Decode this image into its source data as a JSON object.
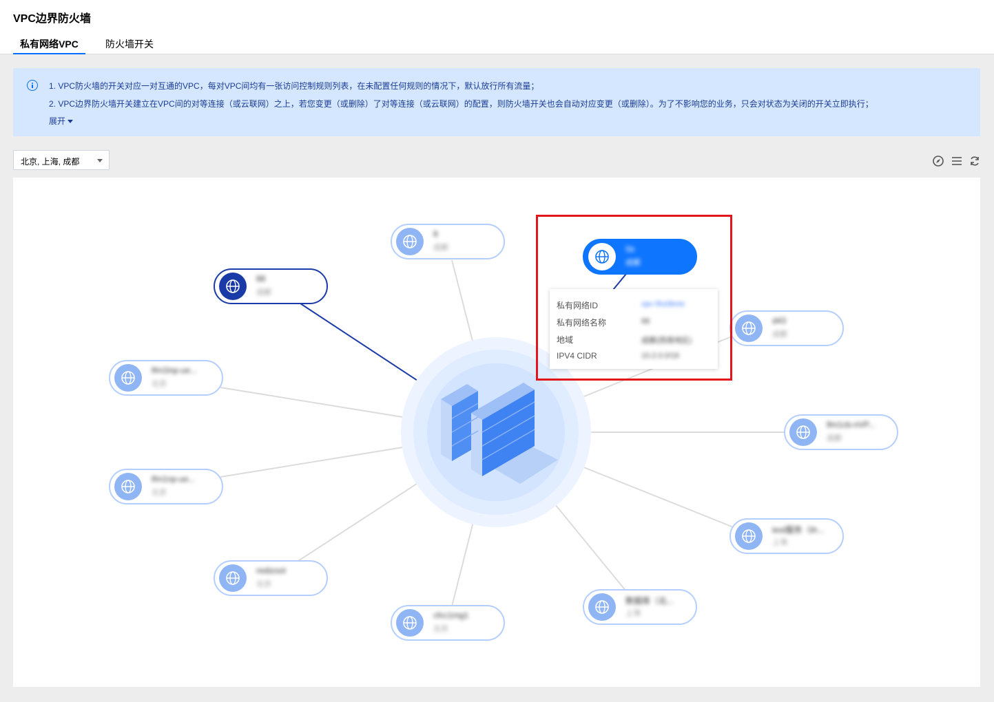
{
  "header": {
    "title": "VPC边界防火墙"
  },
  "tabs": [
    {
      "label": "私有网络VPC",
      "active": true
    },
    {
      "label": "防火墙开关",
      "active": false
    }
  ],
  "notice": {
    "line1": "1. VPC防火墙的开关对应一对互通的VPC，每对VPC间均有一张访问控制规则列表，在未配置任何规则的情况下，默认放行所有流量；",
    "line2": "2. VPC边界防火墙开关建立在VPC间的对等连接（或云联网）之上，若您变更（或删除）了对等连接（或云联网）的配置，则防火墙开关也会自动对应变更（或删除）。为了不影响您的业务，只会对状态为关闭的开关立即执行；",
    "expand_label": "展开"
  },
  "region_select": {
    "value": "北京, 上海, 成都"
  },
  "toolbar": {
    "icons": [
      "compass-icon",
      "list-icon",
      "refresh-icon"
    ]
  },
  "colors": {
    "accent": "#006eff",
    "node_border": "#b3ceff",
    "node_globe": "#8fb5f5",
    "selected": "#1a3aa8",
    "active": "#0e75ff",
    "highlight": "#e2141c"
  },
  "nodes": [
    {
      "name": "8",
      "sub": "成都",
      "state": "normal"
    },
    {
      "name": "88",
      "sub": "成都",
      "state": "selected"
    },
    {
      "name": "5b",
      "sub": "成都",
      "state": "active"
    },
    {
      "name": "d43",
      "sub": "成都",
      "state": "normal"
    },
    {
      "name": "lfm1lnp-ue...",
      "sub": "北京",
      "state": "normal"
    },
    {
      "name": "lfm1cb-nVP...",
      "sub": "成都",
      "state": "normal"
    },
    {
      "name": "lfm1np-ue...",
      "sub": "北京",
      "state": "normal"
    },
    {
      "name": "test服务（th...",
      "sub": "上海",
      "state": "normal"
    },
    {
      "name": "redizoot",
      "sub": "北京",
      "state": "normal"
    },
    {
      "name": "数据库（北...",
      "sub": "上海",
      "state": "normal"
    },
    {
      "name": "cfcc1mg1",
      "sub": "北京",
      "state": "normal"
    }
  ],
  "tooltip": {
    "rows": [
      {
        "label": "私有网络ID",
        "value": "vpc-l5u0bme"
      },
      {
        "label": "私有网络名称",
        "value": "88"
      },
      {
        "label": "地域",
        "value": "成都(西南地区)"
      },
      {
        "label": "IPV4 CIDR",
        "value": "10.2.0.0/16"
      }
    ]
  }
}
